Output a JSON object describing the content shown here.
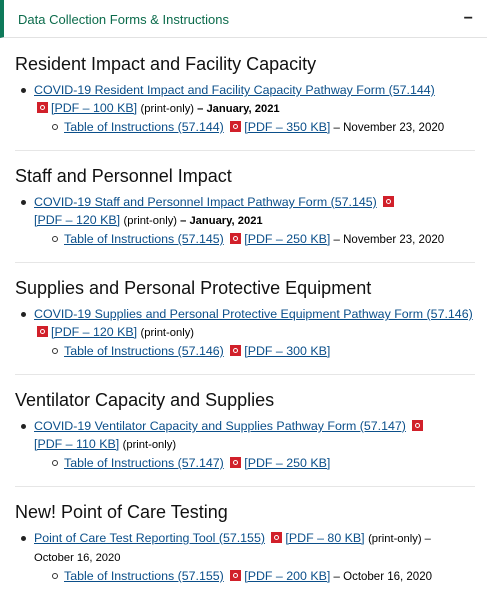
{
  "header": {
    "title": "Data Collection Forms & Instructions",
    "collapse_symbol": "−"
  },
  "colors": {
    "accent": "#0e7a5a",
    "link": "#0b4f8a",
    "pdf": "#d1202a"
  },
  "sections": [
    {
      "title": "Resident Impact and Facility Capacity",
      "form_link": "COVID-19 Resident Impact and Facility Capacity Pathway Form (57.144)",
      "form_pdf": "[PDF – 100 KB]",
      "form_note": "(print-only)",
      "form_date": " – January, 2021",
      "toi_link": "Table of Instructions (57.144)",
      "toi_pdf": "[PDF – 350 KB]",
      "toi_date": " – November 23, 2020"
    },
    {
      "title": "Staff and Personnel Impact",
      "form_link": "COVID-19 Staff and Personnel Impact Pathway Form (57.145)",
      "form_pdf": "[PDF – 120 KB]",
      "form_note": "(print-only)",
      "form_date": " – January, 2021",
      "toi_link": "Table of Instructions (57.145)",
      "toi_pdf": "[PDF – 250 KB]",
      "toi_date": " – November 23, 2020"
    },
    {
      "title": "Supplies and Personal Protective Equipment",
      "form_link": "COVID-19 Supplies and Personal Protective Equipment Pathway Form (57.146)",
      "form_pdf": "[PDF – 120 KB]",
      "form_note": "(print-only)",
      "toi_link": "Table of Instructions (57.146)",
      "toi_pdf": "[PDF – 300 KB]"
    },
    {
      "title": "Ventilator Capacity and Supplies",
      "form_link": "COVID-19 Ventilator Capacity and Supplies Pathway Form (57.147)",
      "form_pdf": "[PDF – 110 KB]",
      "form_note": "(print-only)",
      "toi_link": "Table of Instructions (57.147)",
      "toi_pdf": "[PDF – 250 KB]"
    },
    {
      "title": "New! Point of Care Testing",
      "form_link": "Point of Care Test Reporting Tool (57.155)",
      "form_pdf": "[PDF – 80 KB]",
      "form_note": "(print-only) –",
      "form_date": "October 16, 2020",
      "toi_link": "Table of Instructions (57.155)",
      "toi_pdf": "[PDF – 200 KB]",
      "toi_date": " – October 16, 2020"
    }
  ]
}
